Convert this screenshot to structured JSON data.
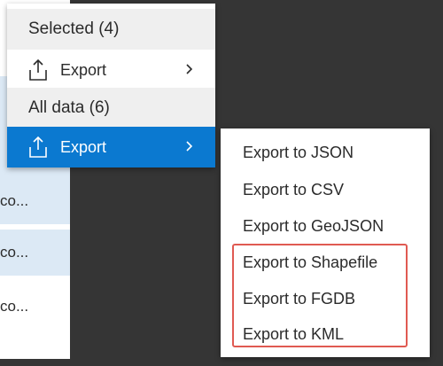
{
  "background_table": {
    "rows": [
      "co...",
      "co...",
      "co..."
    ]
  },
  "menu": {
    "selected_header": "Selected (4)",
    "selected_export_label": "Export",
    "all_data_header": "All data (6)",
    "all_data_export_label": "Export"
  },
  "submenu": {
    "items": [
      "Export to JSON",
      "Export to CSV",
      "Export to GeoJSON",
      "Export to Shapefile",
      "Export to FGDB",
      "Export to KML"
    ]
  },
  "colors": {
    "accent": "#0b79d0",
    "highlight_border": "#e05a52",
    "backdrop": "#353535"
  },
  "icons": {
    "export": "export-icon",
    "chevron": "chevron-right-icon"
  }
}
